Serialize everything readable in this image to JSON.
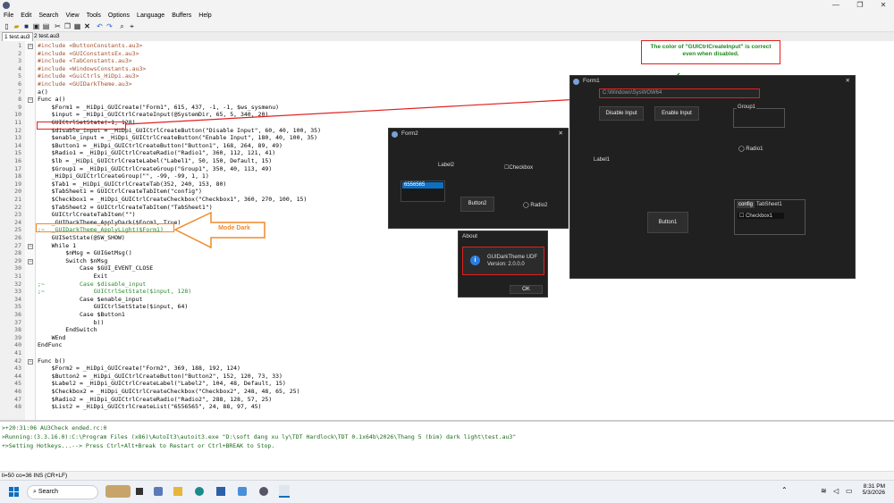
{
  "app": {
    "title": ""
  },
  "window_controls": {
    "minimize": "—",
    "maximize": "❐",
    "close": "✕"
  },
  "menu": [
    "File",
    "Edit",
    "Search",
    "View",
    "Tools",
    "Options",
    "Language",
    "Buffers",
    "Help"
  ],
  "tabs": [
    {
      "label": "1 test.au3",
      "active": true
    },
    {
      "label": "2 test.au3",
      "active": false
    }
  ],
  "editor": {
    "lines": [
      {
        "n": "1",
        "t": "#include <ButtonConstants.au3>"
      },
      {
        "n": "2",
        "t": "#include <GUIConstantsEx.au3>"
      },
      {
        "n": "3",
        "t": "#include <TabConstants.au3>"
      },
      {
        "n": "4",
        "t": "#include <WindowsConstants.au3>"
      },
      {
        "n": "5",
        "t": "#include <GuiCtrls_HiDpi.au3>"
      },
      {
        "n": "6",
        "t": "#include <GUIDarkTheme.au3>"
      },
      {
        "n": "7",
        "t": "a()"
      },
      {
        "n": "8",
        "t": "Func a()"
      },
      {
        "n": "9",
        "t": "    $Form1 = _HiDpi_GUICreate(\"Form1\", 615, 437, -1, -1, $ws_sysmenu)"
      },
      {
        "n": "10",
        "t": "    $input = _HiDpi_GUICtrlCreateInput(@SystemDir, 65, 5, 340, 20)"
      },
      {
        "n": "11",
        "t": "    GUICtrlSetState(-1, 128)"
      },
      {
        "n": "12",
        "t": "    $disable_input = _HiDpi_GUICtrlCreateButton(\"Disable Input\", 60, 40, 100, 35)"
      },
      {
        "n": "13",
        "t": "    $enable_input = _HiDpi_GUICtrlCreateButton(\"Enable Input\", 180, 40, 100, 35)"
      },
      {
        "n": "14",
        "t": "    $Button1 = _HiDpi_GUICtrlCreateButton(\"Button1\", 168, 264, 89, 49)"
      },
      {
        "n": "15",
        "t": "    $Radio1 = _HiDpi_GUICtrlCreateRadio(\"Radio1\", 360, 112, 121, 41)"
      },
      {
        "n": "16",
        "t": "    $lb = _HiDpi_GUICtrlCreateLabel(\"Label1\", 50, 150, Default, 15)"
      },
      {
        "n": "17",
        "t": "    $Group1 = _HiDpi_GUICtrlCreateGroup(\"Group1\", 350, 40, 113, 49)"
      },
      {
        "n": "18",
        "t": "    _HiDpi_GUICtrlCreateGroup(\"\", -99, -99, 1, 1)"
      },
      {
        "n": "19",
        "t": "    $Tab1 = _HiDpi_GUICtrlCreateTab(352, 240, 153, 80)"
      },
      {
        "n": "20",
        "t": "    $TabSheet1 = GUICtrlCreateTabItem(\"config\")"
      },
      {
        "n": "21",
        "t": "    $Checkbox1 = _HiDpi_GUICtrlCreateCheckbox(\"Checkbox1\", 360, 270, 100, 15)"
      },
      {
        "n": "22",
        "t": "    $TabSheet2 = GUICtrlCreateTabItem(\"TabSheet1\")"
      },
      {
        "n": "23",
        "t": "    GUICtrlCreateTabItem(\"\")"
      },
      {
        "n": "24",
        "t": "    _GUIDarkTheme_ApplyDark($Form1, True)"
      },
      {
        "n": "25",
        "t": ";~  _GUIDarkTheme_ApplyLight($Form1)"
      },
      {
        "n": "26",
        "t": "    GUISetState(@SW_SHOW)"
      },
      {
        "n": "27",
        "t": "    While 1"
      },
      {
        "n": "28",
        "t": "        $nMsg = GUIGetMsg()"
      },
      {
        "n": "29",
        "t": "        Switch $nMsg"
      },
      {
        "n": "30",
        "t": "            Case $GUI_EVENT_CLOSE"
      },
      {
        "n": "31",
        "t": "                Exit"
      },
      {
        "n": "32",
        "t": ";~          Case $disable_input"
      },
      {
        "n": "33",
        "t": ";~              GUICtrlSetState($input, 128)"
      },
      {
        "n": "34",
        "t": "            Case $enable_input"
      },
      {
        "n": "35",
        "t": "                GUICtrlSetState($input, 64)"
      },
      {
        "n": "36",
        "t": "            Case $Button1"
      },
      {
        "n": "37",
        "t": "                b()"
      },
      {
        "n": "38",
        "t": "        EndSwitch"
      },
      {
        "n": "39",
        "t": "    WEnd"
      },
      {
        "n": "40",
        "t": "EndFunc"
      },
      {
        "n": "41",
        "t": ""
      },
      {
        "n": "42",
        "t": "Func b()"
      },
      {
        "n": "43",
        "t": "    $Form2 = _HiDpi_GUICreate(\"Form2\", 369, 188, 192, 124)"
      },
      {
        "n": "44",
        "t": "    $Button2 = _HiDpi_GUICtrlCreateButton(\"Button2\", 152, 120, 73, 33)"
      },
      {
        "n": "45",
        "t": "    $Label2 = _HiDpi_GUICtrlCreateLabel(\"Label2\", 104, 48, Default, 15)"
      },
      {
        "n": "46",
        "t": "    $Checkbox2 = _HiDpi_GUICtrlCreateCheckbox(\"Checkbox2\", 248, 48, 65, 25)"
      },
      {
        "n": "47",
        "t": "    $Radio2 = _HiDpi_GUICtrlCreateRadio(\"Radio2\", 288, 128, 57, 25)"
      },
      {
        "n": "48",
        "t": "    $List2 = _HiDpi_GUICtrlCreateList(\"6556565\", 24, 88, 97, 45)"
      }
    ]
  },
  "output": [
    ">+20:31:06 AU3Check ended.rc:0",
    ">Running:(3.3.16.0):C:\\Program Files (x86)\\AutoIt3\\autoit3.exe \"D:\\soft dang xu ly\\TDT Hardlock\\TDT 0.1x64b\\2026\\Thang 5 (bim) dark light\\test.au3\"",
    "+>Setting Hotkeys...--> Press Ctrl+Alt+Break to Restart or Ctrl+BREAK to Stop."
  ],
  "status": "li=50 co=36 INS (CR+LF)",
  "form1": {
    "title": "Form1",
    "input_value": "C:\\Windows\\SysWOW64",
    "disable_btn": "Disable Input",
    "enable_btn": "Enable Input",
    "group": "Group1",
    "radio": "Radio1",
    "label": "Label1",
    "button": "Button1",
    "tab_config": "config",
    "tab_sheet": "TabSheet1",
    "checkbox": "Checkbox1"
  },
  "form2": {
    "title": "Form2",
    "label": "Label2",
    "checkbox": "Checkbox",
    "list_item": "6556565",
    "button": "Button2",
    "radio": "Radio2"
  },
  "about": {
    "title": "About",
    "name": "GUIDarkTheme UDF",
    "version": "Version:   2.0.0.0",
    "ok": "OK"
  },
  "annotations": {
    "top_note": "The color of \"GUICtrlCreateInput\" is correct even when disabled.",
    "mode_dark": "Mode Dark"
  },
  "taskbar": {
    "search": "Search",
    "time": "8:31 PM",
    "date": "5/3/2026"
  },
  "colors": {
    "accent": "#0e6fc1",
    "annot_red": "#e02020",
    "annot_green": "#1e8a1e",
    "arrow_orange": "#f08a2a"
  }
}
